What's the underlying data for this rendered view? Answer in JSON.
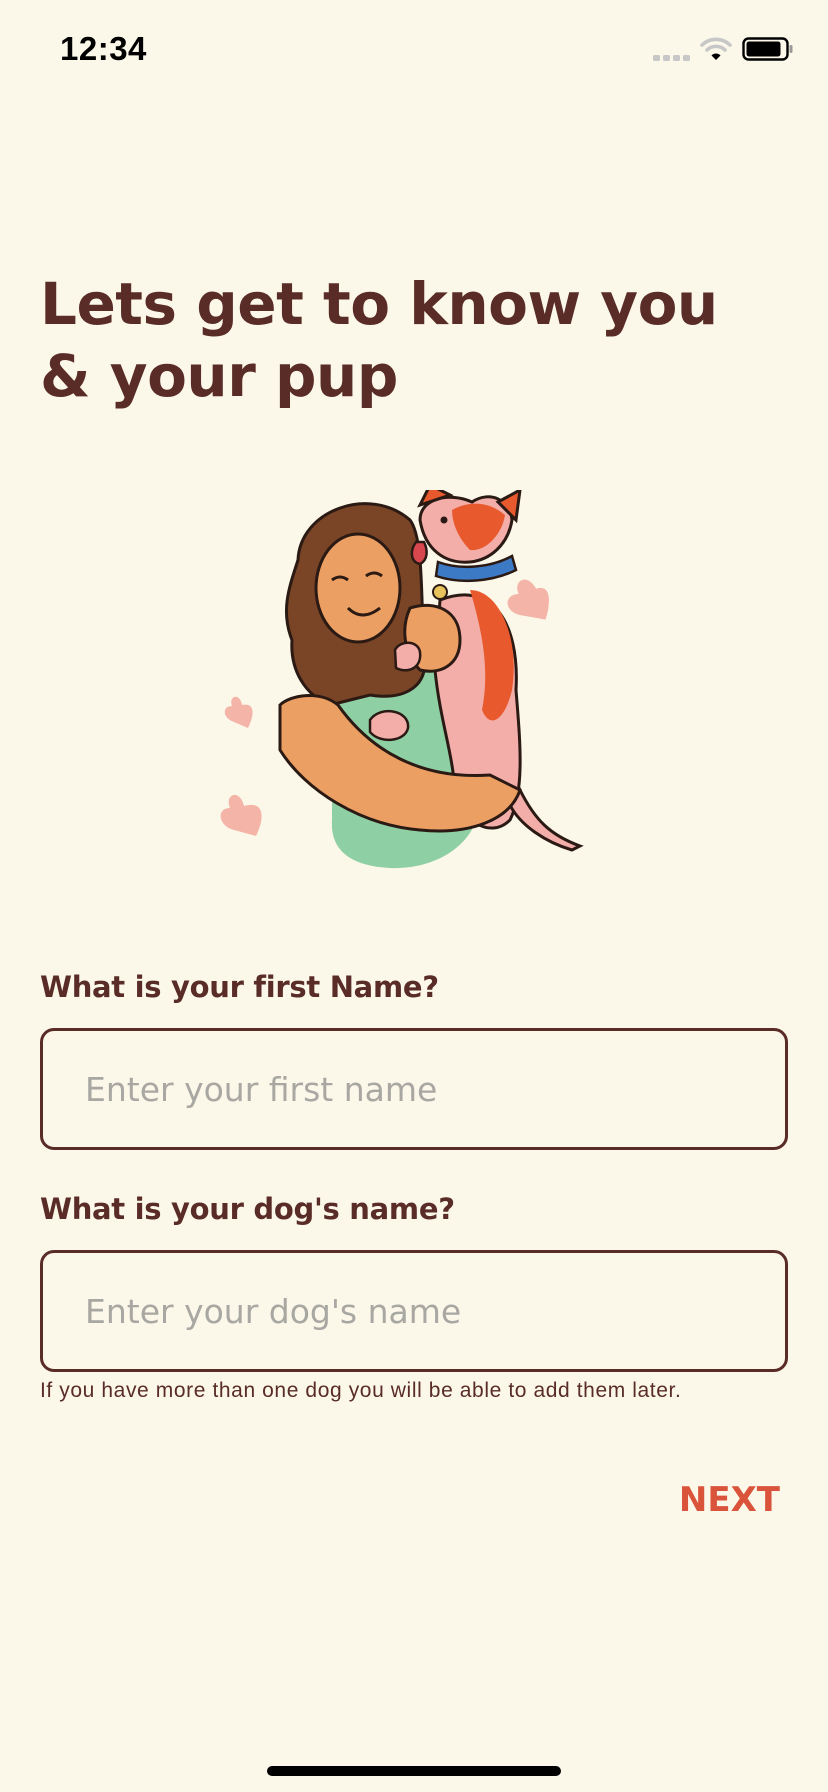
{
  "status_bar": {
    "time": "12:34",
    "icons": [
      "signal-icon",
      "wifi-icon",
      "battery-icon"
    ]
  },
  "title": "Lets get to know you & your pup",
  "illustration": {
    "subject": "woman hugging dog with hearts"
  },
  "form": {
    "first_name": {
      "label": "What is your first Name?",
      "placeholder": "Enter your first name",
      "value": ""
    },
    "dog_name": {
      "label": "What is your dog's name?",
      "placeholder": "Enter your dog's name",
      "value": "",
      "helper": "If you have more than one dog you will be able to add them later."
    }
  },
  "actions": {
    "next_label": "NEXT"
  },
  "colors": {
    "background": "#fbf8ea",
    "text_primary": "#5a2c28",
    "placeholder": "#a9a7a2",
    "accent": "#d9543a"
  }
}
